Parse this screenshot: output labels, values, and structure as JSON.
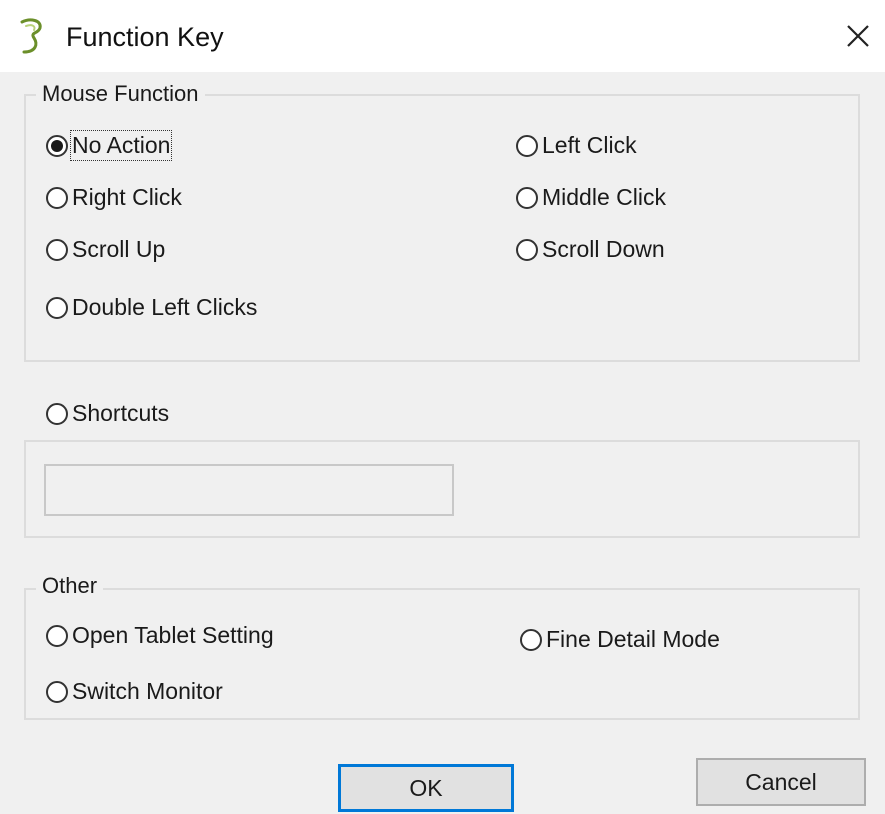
{
  "window": {
    "title": "Function Key",
    "icon": "pen-tablet-app-icon",
    "close_icon": "close-x-icon"
  },
  "mouse_function": {
    "legend": "Mouse Function",
    "options": [
      {
        "label": "No Action",
        "selected": true
      },
      {
        "label": "Left Click",
        "selected": false
      },
      {
        "label": "Right Click",
        "selected": false
      },
      {
        "label": "Middle Click",
        "selected": false
      },
      {
        "label": "Scroll Up",
        "selected": false
      },
      {
        "label": "Scroll Down",
        "selected": false
      },
      {
        "label": "Double Left Clicks",
        "selected": false
      }
    ]
  },
  "shortcuts": {
    "label": "Shortcuts",
    "selected": false,
    "value": ""
  },
  "other": {
    "legend": "Other",
    "options": [
      {
        "label": "Open Tablet Setting",
        "selected": false
      },
      {
        "label": "Fine Detail Mode",
        "selected": false
      },
      {
        "label": "Switch Monitor",
        "selected": false
      }
    ]
  },
  "buttons": {
    "ok": "OK",
    "cancel": "Cancel"
  },
  "colors": {
    "dialog_bg": "#f0f0f0",
    "default_button_border": "#0078d7",
    "button_bg": "#e1e1e1"
  }
}
